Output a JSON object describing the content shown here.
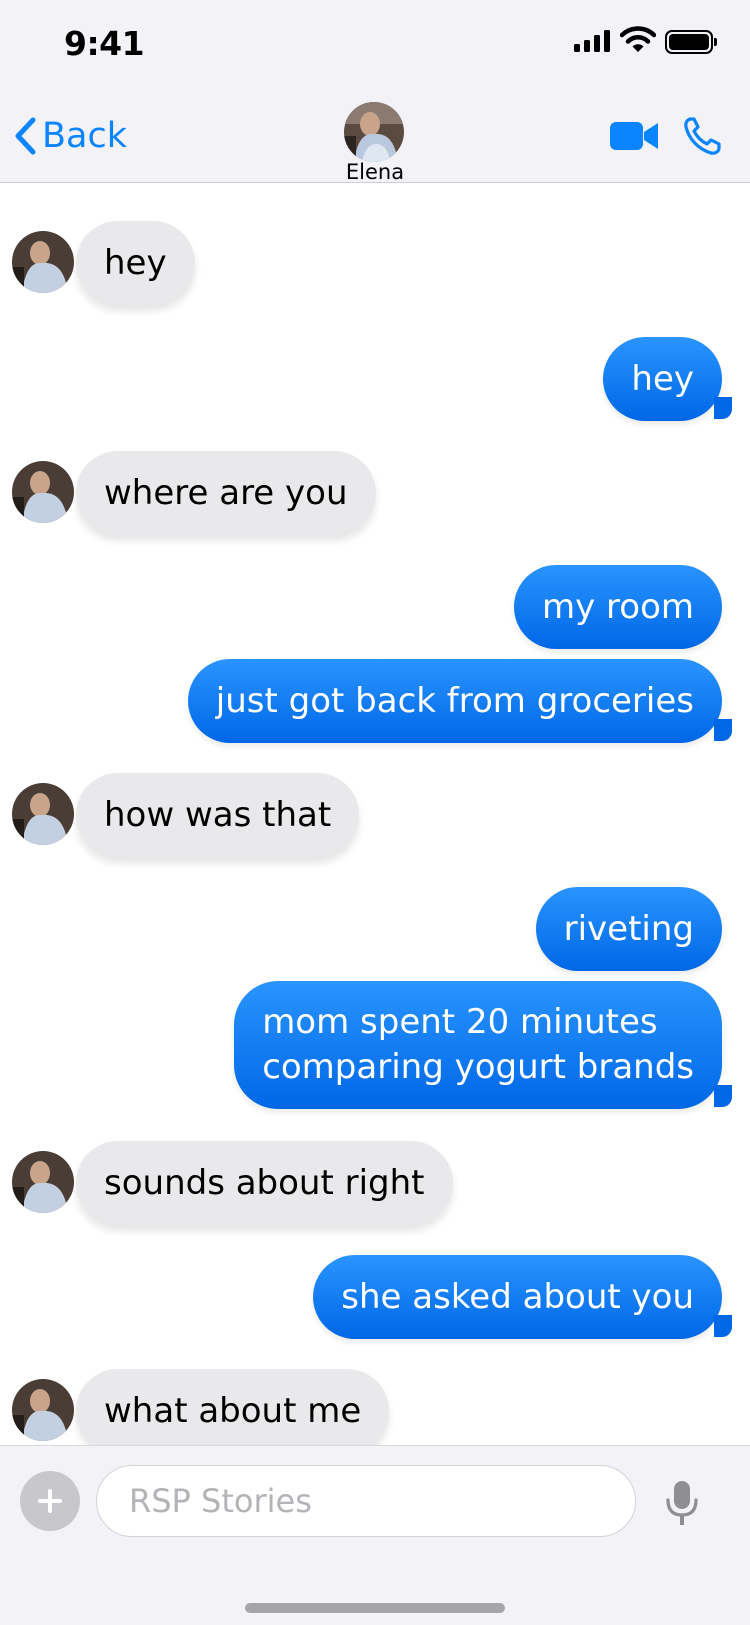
{
  "status_bar": {
    "time": "9:41"
  },
  "header": {
    "back_label": "Back",
    "contact_name": "Elena"
  },
  "messages": [
    {
      "direction": "in",
      "text": "hey"
    },
    {
      "direction": "out",
      "text": "hey"
    },
    {
      "direction": "in",
      "text": "where are you"
    },
    {
      "direction": "out",
      "text": "my room"
    },
    {
      "direction": "out",
      "text": "just got back from groceries"
    },
    {
      "direction": "in",
      "text": "how was that"
    },
    {
      "direction": "out",
      "text": "riveting"
    },
    {
      "direction": "out",
      "lines": [
        "mom spent 20 minutes",
        "comparing yogurt brands"
      ]
    },
    {
      "direction": "in",
      "text": "sounds about right"
    },
    {
      "direction": "out",
      "text": "she asked about you"
    },
    {
      "direction": "in",
      "text": "what about me"
    }
  ],
  "composer": {
    "placeholder": "RSP Stories"
  },
  "colors": {
    "accent": "#0a84ff",
    "outgoing_bubble": "#0a7cff",
    "incoming_bubble": "#e9e9eb"
  },
  "icons": [
    "back-chevron-icon",
    "video-icon",
    "phone-icon",
    "plus-icon",
    "mic-icon",
    "signal-icon",
    "wifi-icon",
    "battery-icon"
  ]
}
